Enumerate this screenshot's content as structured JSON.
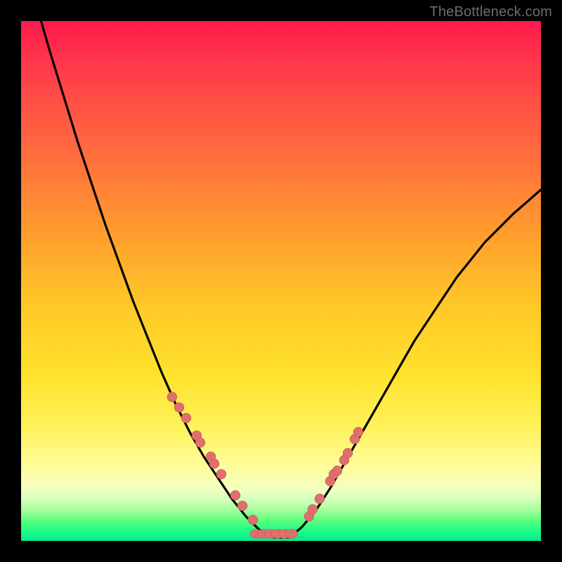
{
  "watermark": "TheBottleneck.com",
  "colors": {
    "background": "#000000",
    "gradient_top": "#ff1a4d",
    "gradient_bottom": "#06e98f",
    "curve": "#000000",
    "marker_fill": "#e06f6d",
    "marker_stroke": "#b84f4a"
  },
  "chart_data": {
    "type": "line",
    "title": "",
    "xlabel": "",
    "ylabel": "",
    "xlim": [
      0,
      100
    ],
    "ylim": [
      0,
      100
    ],
    "note": "Axes unlabeled in source image; values are relative percentages across the 740×740 plot area. y increases downward.",
    "series": [
      {
        "name": "v-curve",
        "x": [
          0.0,
          2.7,
          5.41,
          8.11,
          10.81,
          13.51,
          16.22,
          18.92,
          21.62,
          24.32,
          27.03,
          29.73,
          32.43,
          35.14,
          37.84,
          40.54,
          43.24,
          44.59,
          45.95,
          48.65,
          51.35,
          52.03,
          54.05,
          56.76,
          59.46,
          62.16,
          64.86,
          67.57,
          70.27,
          72.97,
          75.68,
          78.38,
          81.08,
          83.78,
          86.49,
          89.19,
          91.89,
          94.59,
          97.3,
          100.0
        ],
        "y": [
          -13.51,
          -4.05,
          5.41,
          14.19,
          22.97,
          31.08,
          39.19,
          46.62,
          54.05,
          60.81,
          67.57,
          73.65,
          79.05,
          83.78,
          87.84,
          91.89,
          95.27,
          96.62,
          97.97,
          99.32,
          99.32,
          99.05,
          97.3,
          94.05,
          89.86,
          85.14,
          80.41,
          75.68,
          70.95,
          66.22,
          61.49,
          57.43,
          53.38,
          49.32,
          45.95,
          42.57,
          39.86,
          37.16,
          34.8,
          32.43
        ]
      }
    ],
    "markers_left": {
      "x": [
        29.05,
        30.41,
        31.76,
        33.78,
        34.46,
        36.49,
        37.16,
        38.51,
        41.22,
        42.57,
        44.59
      ],
      "y": [
        72.3,
        74.32,
        76.35,
        79.73,
        81.08,
        83.78,
        85.14,
        87.16,
        91.22,
        93.24,
        95.95
      ]
    },
    "markers_right": {
      "x": [
        55.41,
        56.08,
        57.43,
        59.46,
        60.14,
        60.81,
        62.16,
        62.84,
        64.19,
        64.86
      ],
      "y": [
        95.27,
        93.92,
        91.89,
        88.51,
        87.16,
        86.49,
        84.46,
        83.11,
        80.41,
        79.05
      ]
    },
    "flat_bottom": {
      "x": [
        45.27,
        46.62,
        47.97,
        49.32,
        50.68,
        52.03
      ],
      "y": [
        98.65,
        98.65,
        98.65,
        98.65,
        98.65,
        98.65
      ]
    }
  }
}
